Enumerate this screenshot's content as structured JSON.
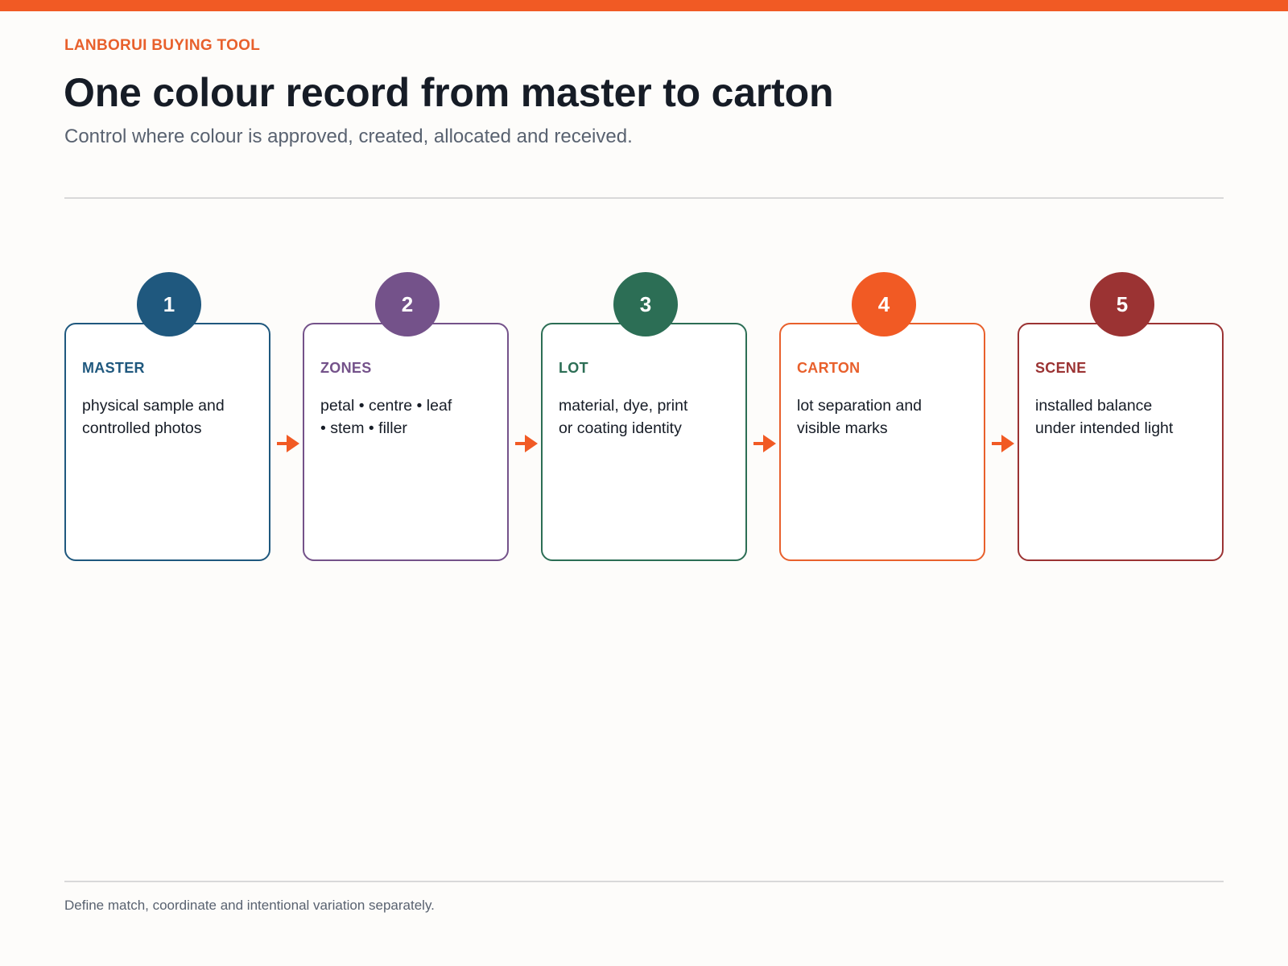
{
  "header": {
    "eyebrow": "LANBORUI BUYING TOOL",
    "title": "One colour record from master to carton",
    "subtitle": "Control where colour is approved, created, allocated and received."
  },
  "colors": {
    "accent": "#f15a24",
    "step_1": "#1f587e",
    "step_2": "#74528a",
    "step_3": "#2c6e55",
    "step_4": "#f15a24",
    "step_5": "#9b3333"
  },
  "steps": [
    {
      "number": "1",
      "label": "MASTER",
      "lines": [
        "physical sample and",
        "controlled photos"
      ]
    },
    {
      "number": "2",
      "label": "ZONES",
      "lines": [
        "petal • centre • leaf",
        "• stem • filler"
      ]
    },
    {
      "number": "3",
      "label": "LOT",
      "lines": [
        "material, dye, print",
        "or coating identity"
      ]
    },
    {
      "number": "4",
      "label": "CARTON",
      "lines": [
        "lot separation and",
        "visible marks"
      ]
    },
    {
      "number": "5",
      "label": "SCENE",
      "lines": [
        "installed balance",
        "under intended light"
      ]
    }
  ],
  "connector_icon": "arrow-right-icon",
  "footer": {
    "note": "Define match, coordinate and intentional variation separately."
  }
}
